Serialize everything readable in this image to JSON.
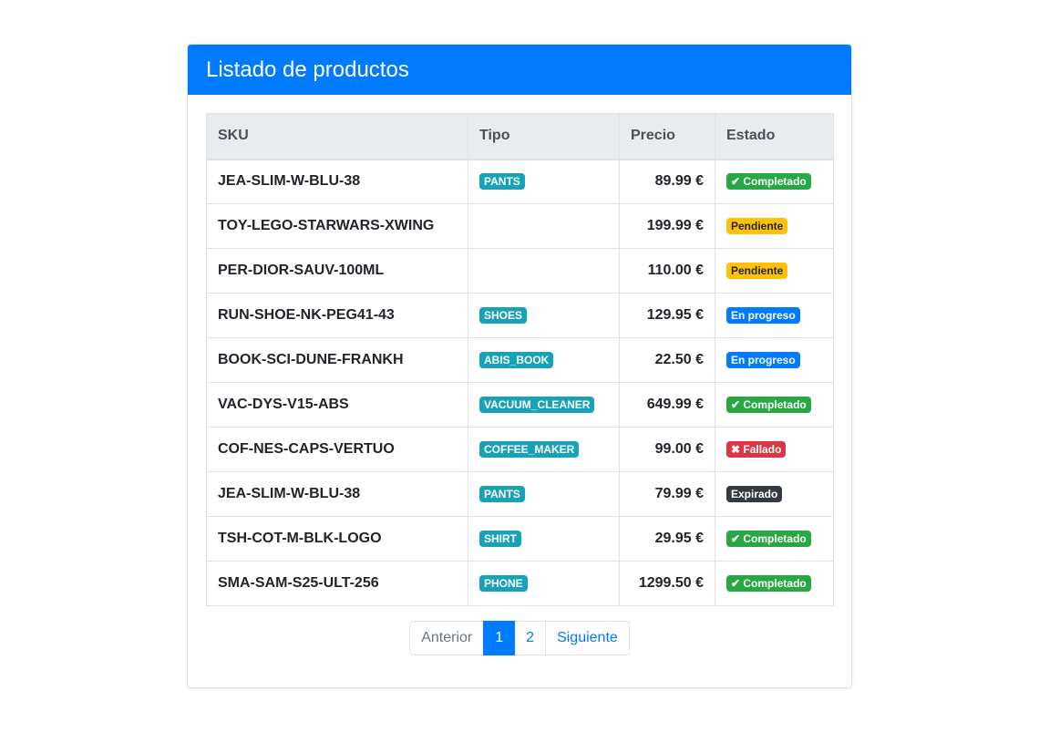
{
  "header": {
    "title": "Listado de productos"
  },
  "table": {
    "columns": [
      "SKU",
      "Tipo",
      "Precio",
      "Estado"
    ],
    "rows": [
      {
        "sku": "JEA-SLIM-W-BLU-38",
        "tipo": "PANTS",
        "precio": "89.99 €",
        "estado": "✔ Completado",
        "estado_kind": "success"
      },
      {
        "sku": "TOY-LEGO-STARWARS-XWING",
        "tipo": "",
        "precio": "199.99 €",
        "estado": "Pendiente",
        "estado_kind": "warning"
      },
      {
        "sku": "PER-DIOR-SAUV-100ML",
        "tipo": "",
        "precio": "110.00 €",
        "estado": "Pendiente",
        "estado_kind": "warning"
      },
      {
        "sku": "RUN-SHOE-NK-PEG41-43",
        "tipo": "SHOES",
        "precio": "129.95 €",
        "estado": "En progreso",
        "estado_kind": "primary"
      },
      {
        "sku": "BOOK-SCI-DUNE-FRANKH",
        "tipo": "ABIS_BOOK",
        "precio": "22.50 €",
        "estado": "En progreso",
        "estado_kind": "primary"
      },
      {
        "sku": "VAC-DYS-V15-ABS",
        "tipo": "VACUUM_CLEANER",
        "precio": "649.99 €",
        "estado": "✔ Completado",
        "estado_kind": "success"
      },
      {
        "sku": "COF-NES-CAPS-VERTUO",
        "tipo": "COFFEE_MAKER",
        "precio": "99.00 €",
        "estado": "✖ Fallado",
        "estado_kind": "danger"
      },
      {
        "sku": "JEA-SLIM-W-BLU-38",
        "tipo": "PANTS",
        "precio": "79.99 €",
        "estado": "Expirado",
        "estado_kind": "dark"
      },
      {
        "sku": "TSH-COT-M-BLK-LOGO",
        "tipo": "SHIRT",
        "precio": "29.95 €",
        "estado": "✔ Completado",
        "estado_kind": "success"
      },
      {
        "sku": "SMA-SAM-S25-ULT-256",
        "tipo": "PHONE",
        "precio": "1299.50 €",
        "estado": "✔ Completado",
        "estado_kind": "success"
      }
    ]
  },
  "pagination": {
    "prev_label": "Anterior",
    "pages": [
      "1",
      "2"
    ],
    "active_page": "1",
    "next_label": "Siguiente"
  },
  "colors": {
    "primary": "#007bff",
    "info": "#17a2b8",
    "success": "#28a745",
    "warning": "#ffc107",
    "danger": "#dc3545",
    "dark": "#343a40"
  }
}
